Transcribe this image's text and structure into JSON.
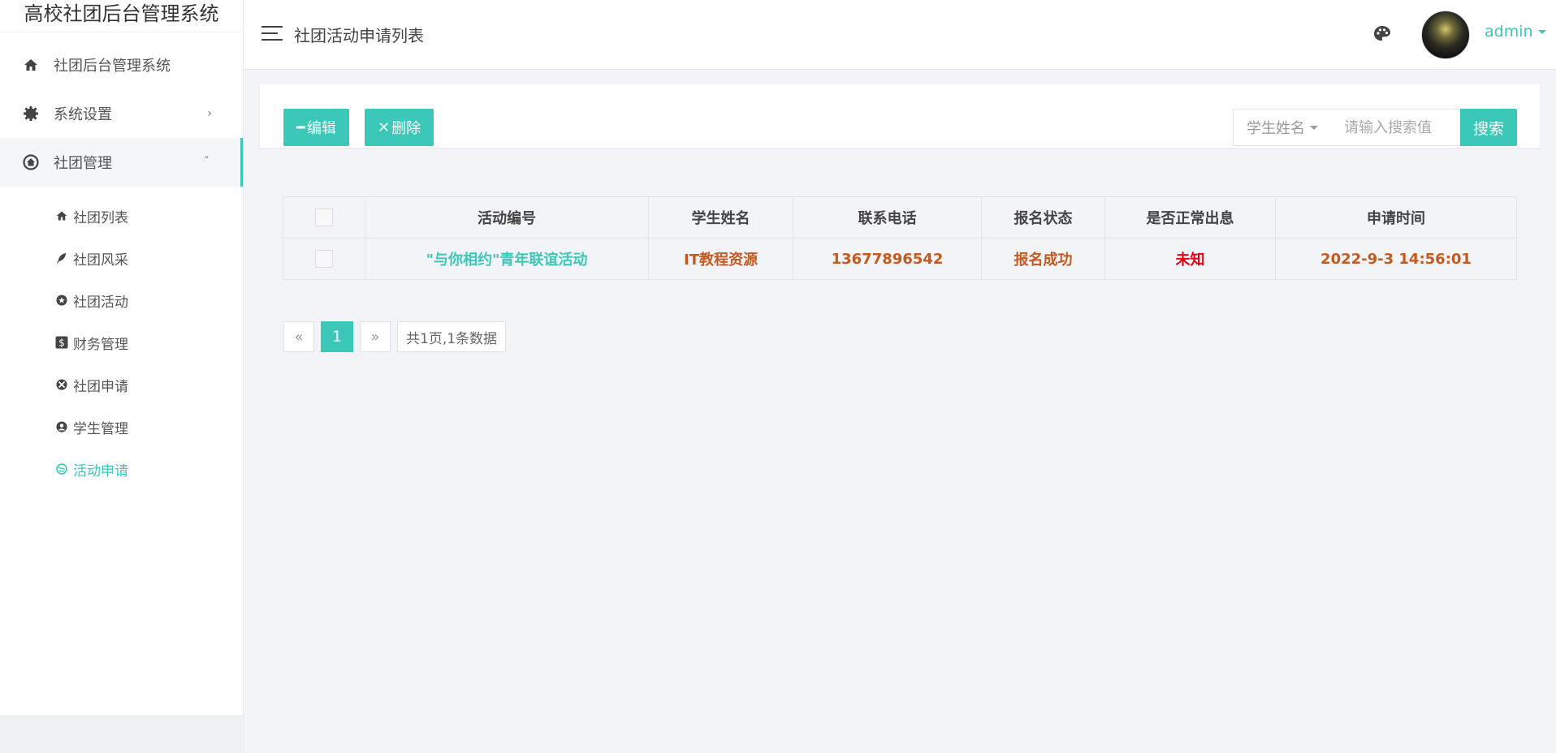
{
  "app": {
    "title": "高校社团后台管理系统"
  },
  "sidebar": {
    "top_items": [
      {
        "label": "社团后台管理系统",
        "icon": "home-icon"
      },
      {
        "label": "系统设置",
        "icon": "gear-icon",
        "arrow": "›"
      },
      {
        "label": "社团管理",
        "icon": "house-circle-icon",
        "arrow": "ˇ"
      }
    ],
    "sub_items": [
      {
        "label": "社团列表",
        "icon": "home-icon"
      },
      {
        "label": "社团风采",
        "icon": "feather-icon"
      },
      {
        "label": "社团活动",
        "icon": "star-circle-icon"
      },
      {
        "label": "财务管理",
        "icon": "dollar-icon"
      },
      {
        "label": "社团申请",
        "icon": "xbox-icon"
      },
      {
        "label": "学生管理",
        "icon": "user-circle-icon"
      },
      {
        "label": "活动申请",
        "icon": "globe-icon",
        "active": true
      }
    ]
  },
  "header": {
    "title": "社团活动申请列表",
    "user": "admin"
  },
  "toolbar": {
    "edit_label": "编辑",
    "edit_symbol": "━",
    "delete_label": "删除",
    "delete_symbol": "✕",
    "search_field": "学生姓名",
    "search_placeholder": "请输入搜索值",
    "search_label": "搜索"
  },
  "table": {
    "headers": [
      "活动编号",
      "学生姓名",
      "联系电话",
      "报名状态",
      "是否正常出息",
      "申请时间"
    ],
    "rows": [
      [
        "\"与你相约\"青年联谊活动",
        "IT教程资源",
        "13677896542",
        "报名成功",
        "未知",
        "2022-9-3 14:56:01"
      ]
    ]
  },
  "pagination": {
    "prev": "«",
    "current": "1",
    "next": "»",
    "info": "共1页,1条数据"
  },
  "colors": {
    "accent": "#3cc8b8",
    "orange": "#c65a1e",
    "red": "#e60012"
  }
}
